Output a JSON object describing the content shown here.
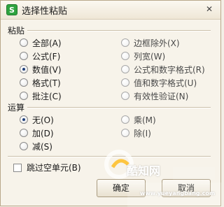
{
  "window": {
    "title": "选择性粘贴",
    "app_icon_letter": "S",
    "close_glyph": "✕"
  },
  "paste_section": {
    "label": "粘贴",
    "options": [
      {
        "label": "全部(A)",
        "checked": false,
        "disabled": false
      },
      {
        "label": "公式(F)",
        "checked": false,
        "disabled": false
      },
      {
        "label": "数值(V)",
        "checked": true,
        "disabled": false
      },
      {
        "label": "格式(T)",
        "checked": false,
        "disabled": false
      },
      {
        "label": "批注(C)",
        "checked": false,
        "disabled": false
      },
      {
        "label": "边框除外(X)",
        "checked": false,
        "disabled": true
      },
      {
        "label": "列宽(W)",
        "checked": false,
        "disabled": true
      },
      {
        "label": "公式和数字格式(R)",
        "checked": false,
        "disabled": true
      },
      {
        "label": "值和数字格式(U)",
        "checked": false,
        "disabled": true
      },
      {
        "label": "有效性验证(N)",
        "checked": false,
        "disabled": true
      }
    ]
  },
  "operation_section": {
    "label": "运算",
    "options": [
      {
        "label": "无(O)",
        "checked": true,
        "disabled": false
      },
      {
        "label": "加(D)",
        "checked": false,
        "disabled": false
      },
      {
        "label": "减(S)",
        "checked": false,
        "disabled": false
      },
      {
        "label": "乘(M)",
        "checked": false,
        "disabled": true
      },
      {
        "label": "除(I)",
        "checked": false,
        "disabled": true
      }
    ]
  },
  "skip_blanks": {
    "label": "跳过空单元(B)",
    "checked": false
  },
  "buttons": {
    "ok": "确定",
    "cancel": "取消"
  },
  "watermark": {
    "brand": "酷知网",
    "site_url": "www.yueyangbang.com"
  },
  "colors": {
    "dialog_bg": "#f7f3ea",
    "border": "#b9a88a",
    "accent": "#1f3f7a",
    "icon_green": "#2fa33f"
  }
}
